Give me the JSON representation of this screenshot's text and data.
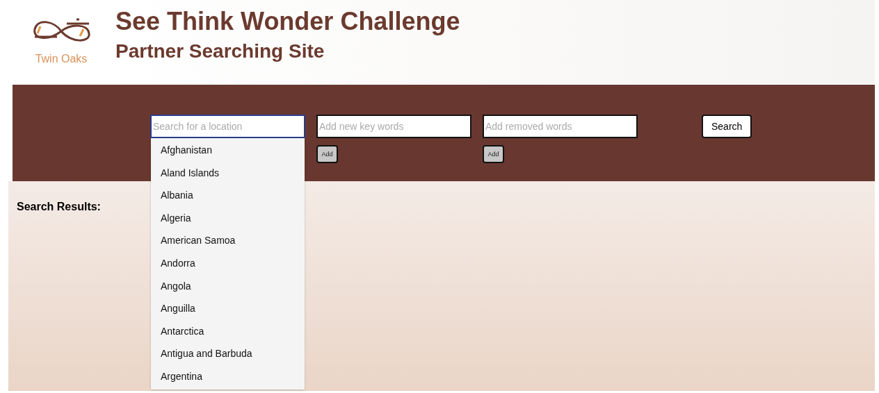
{
  "header": {
    "logo_text": "Twin Oaks",
    "title": "See Think Wonder Challenge",
    "subtitle": "Partner Searching Site"
  },
  "search_bar": {
    "location_field": {
      "placeholder": "Search for a location",
      "focused": true
    },
    "keywords_field": {
      "placeholder": "Add new key words",
      "button": "Add"
    },
    "removed_field": {
      "placeholder": "Add removed words",
      "button": "Add"
    },
    "search_button": "Search"
  },
  "location_dropdown": [
    "Afghanistan",
    "Aland Islands",
    "Albania",
    "Algeria",
    "American Samoa",
    "Andorra",
    "Angola",
    "Anguilla",
    "Antarctica",
    "Antigua and Barbuda",
    "Argentina"
  ],
  "results": {
    "heading": "Search Results:"
  }
}
